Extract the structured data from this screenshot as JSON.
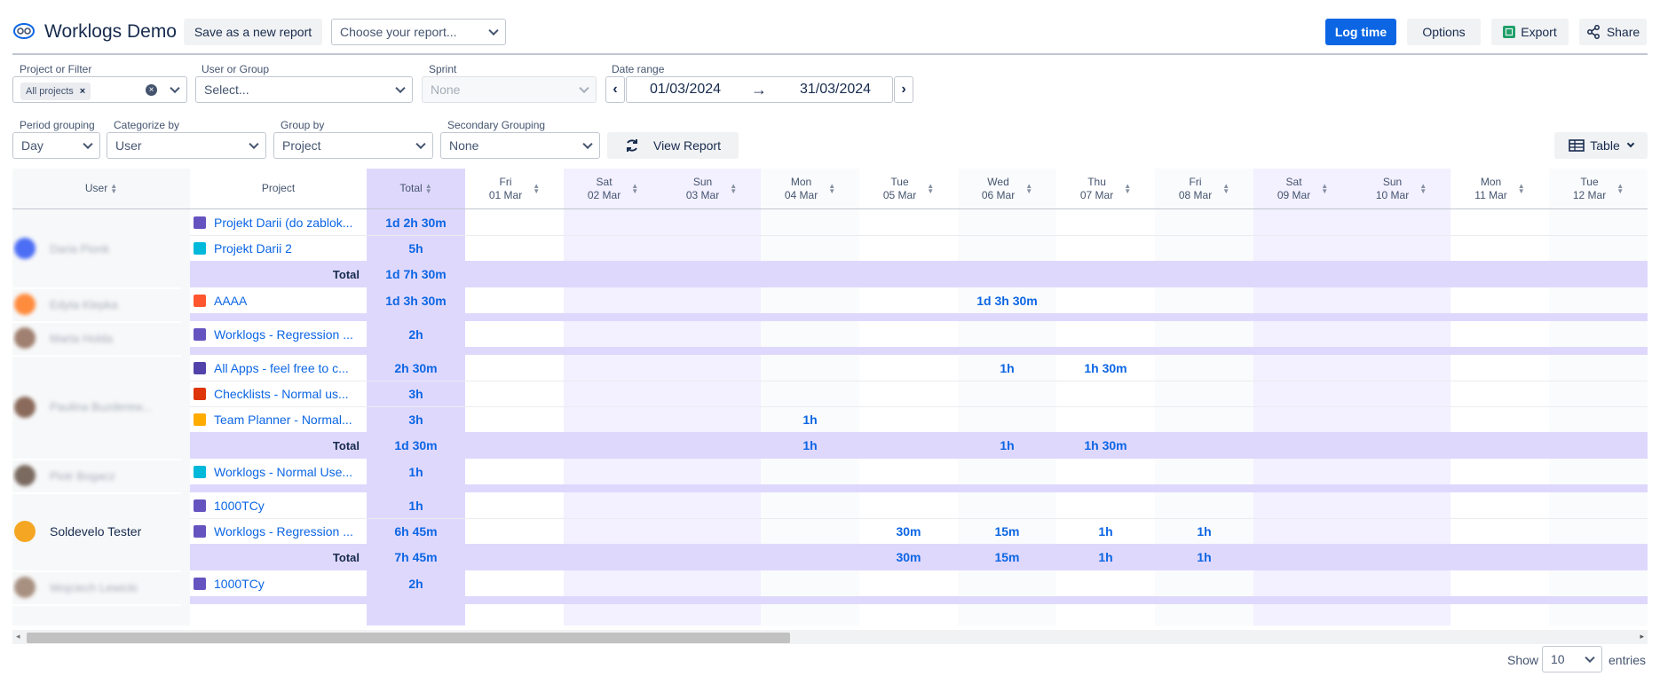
{
  "header": {
    "title": "Worklogs Demo",
    "save_label": "Save as a new report",
    "report_placeholder": "Choose your report...",
    "log_time": "Log time",
    "options": "Options",
    "export": "Export",
    "share": "Share",
    "accent": "#0c66e4"
  },
  "filters": {
    "project_label": "Project or Filter",
    "project_tag": "All projects",
    "user_label": "User or Group",
    "user_placeholder": "Select...",
    "sprint_label": "Sprint",
    "sprint_value": "None",
    "date_label": "Date range",
    "date_from": "01/03/2024",
    "date_to": "31/03/2024",
    "period_label": "Period grouping",
    "period_value": "Day",
    "categorize_label": "Categorize by",
    "categorize_value": "User",
    "groupby_label": "Group by",
    "groupby_value": "Project",
    "secondary_label": "Secondary Grouping",
    "secondary_value": "None",
    "view_report": "View Report",
    "table_view": "Table"
  },
  "table": {
    "col_user": "User",
    "col_project": "Project",
    "col_total": "Total",
    "days": [
      {
        "dow": "Fri",
        "date": "01 Mar",
        "weekend": false
      },
      {
        "dow": "Sat",
        "date": "02 Mar",
        "weekend": true
      },
      {
        "dow": "Sun",
        "date": "03 Mar",
        "weekend": true
      },
      {
        "dow": "Mon",
        "date": "04 Mar",
        "weekend": false
      },
      {
        "dow": "Tue",
        "date": "05 Mar",
        "weekend": false
      },
      {
        "dow": "Wed",
        "date": "06 Mar",
        "weekend": false
      },
      {
        "dow": "Thu",
        "date": "07 Mar",
        "weekend": false
      },
      {
        "dow": "Fri",
        "date": "08 Mar",
        "weekend": false
      },
      {
        "dow": "Sat",
        "date": "09 Mar",
        "weekend": true
      },
      {
        "dow": "Sun",
        "date": "10 Mar",
        "weekend": true
      },
      {
        "dow": "Mon",
        "date": "11 Mar",
        "weekend": false
      },
      {
        "dow": "Tue",
        "date": "12 Mar",
        "weekend": false
      }
    ],
    "total_label": "Total",
    "groups": [
      {
        "user": "Daria Pionk",
        "avatar_color": "#4c6ef5",
        "blurred": true,
        "rows": [
          {
            "project": "Projekt Darii (do zablok...",
            "icon_color": "#6554c0",
            "total": "1d 2h 30m",
            "days": [
              "",
              "",
              "",
              "",
              "",
              "",
              "",
              "",
              "",
              "",
              "",
              ""
            ]
          },
          {
            "project": "Projekt Darii 2",
            "icon_color": "#00b8d9",
            "total": "5h",
            "days": [
              "",
              "",
              "",
              "",
              "",
              "",
              "",
              "",
              "",
              "",
              "",
              ""
            ]
          }
        ],
        "subtotal": {
          "total": "1d 7h 30m",
          "days": [
            "",
            "",
            "",
            "",
            "",
            "",
            "",
            "",
            "",
            "",
            "",
            ""
          ]
        }
      },
      {
        "user": "Edyta Klepka",
        "avatar_color": "#ff8b3d",
        "blurred": true,
        "rows": [
          {
            "project": "AAAA",
            "icon_color": "#ff5630",
            "total": "1d 3h 30m",
            "days": [
              "",
              "",
              "",
              "",
              "",
              "1d 3h 30m",
              "",
              "",
              "",
              "",
              "",
              ""
            ]
          }
        ]
      },
      {
        "user": "Marta Holda",
        "avatar_color": "#a08070",
        "blurred": true,
        "rows": [
          {
            "project": "Worklogs - Regression ...",
            "icon_color": "#6554c0",
            "total": "2h",
            "days": [
              "",
              "",
              "",
              "",
              "",
              "",
              "",
              "",
              "",
              "",
              "",
              ""
            ]
          }
        ]
      },
      {
        "user": "Paulina Buzderew...",
        "avatar_color": "#8a6a5a",
        "blurred": true,
        "rows": [
          {
            "project": "All Apps - feel free to c...",
            "icon_color": "#5243aa",
            "total": "2h 30m",
            "days": [
              "",
              "",
              "",
              "",
              "",
              "1h",
              "1h 30m",
              "",
              "",
              "",
              "",
              ""
            ]
          },
          {
            "project": "Checklists - Normal us...",
            "icon_color": "#de350b",
            "total": "3h",
            "days": [
              "",
              "",
              "",
              "",
              "",
              "",
              "",
              "",
              "",
              "",
              "",
              ""
            ]
          },
          {
            "project": "Team Planner - Normal...",
            "icon_color": "#ffab00",
            "total": "3h",
            "days": [
              "",
              "",
              "",
              "1h",
              "",
              "",
              "",
              "",
              "",
              "",
              "",
              ""
            ]
          }
        ],
        "subtotal": {
          "total": "1d 30m",
          "days": [
            "",
            "",
            "",
            "1h",
            "",
            "1h",
            "1h 30m",
            "",
            "",
            "",
            "",
            ""
          ]
        }
      },
      {
        "user": "Piotr Bogacz",
        "avatar_color": "#7a6a60",
        "blurred": true,
        "rows": [
          {
            "project": "Worklogs - Normal Use...",
            "icon_color": "#00b8d9",
            "total": "1h",
            "days": [
              "",
              "",
              "",
              "",
              "",
              "",
              "",
              "",
              "",
              "",
              "",
              ""
            ]
          }
        ]
      },
      {
        "user": "Soldevelo Tester",
        "avatar_color": "#f5a623",
        "blurred": false,
        "rows": [
          {
            "project": "1000TCy",
            "icon_color": "#6554c0",
            "total": "1h",
            "days": [
              "",
              "",
              "",
              "",
              "",
              "",
              "",
              "",
              "",
              "",
              "",
              ""
            ]
          },
          {
            "project": "Worklogs - Regression ...",
            "icon_color": "#6554c0",
            "total": "6h 45m",
            "days": [
              "",
              "",
              "",
              "",
              "30m",
              "15m",
              "1h",
              "1h",
              "",
              "",
              "",
              ""
            ]
          }
        ],
        "subtotal": {
          "total": "7h 45m",
          "days": [
            "",
            "",
            "",
            "",
            "30m",
            "15m",
            "1h",
            "1h",
            "",
            "",
            "",
            ""
          ]
        }
      },
      {
        "user": "Wojciech Lewicki",
        "avatar_color": "#a89080",
        "blurred": true,
        "rows": [
          {
            "project": "1000TCy",
            "icon_color": "#6554c0",
            "total": "2h",
            "days": [
              "",
              "",
              "",
              "",
              "",
              "",
              "",
              "",
              "",
              "",
              "",
              ""
            ]
          }
        ]
      }
    ]
  },
  "footer": {
    "show_label": "Show",
    "entries_value": "10",
    "entries_label": "entries"
  }
}
